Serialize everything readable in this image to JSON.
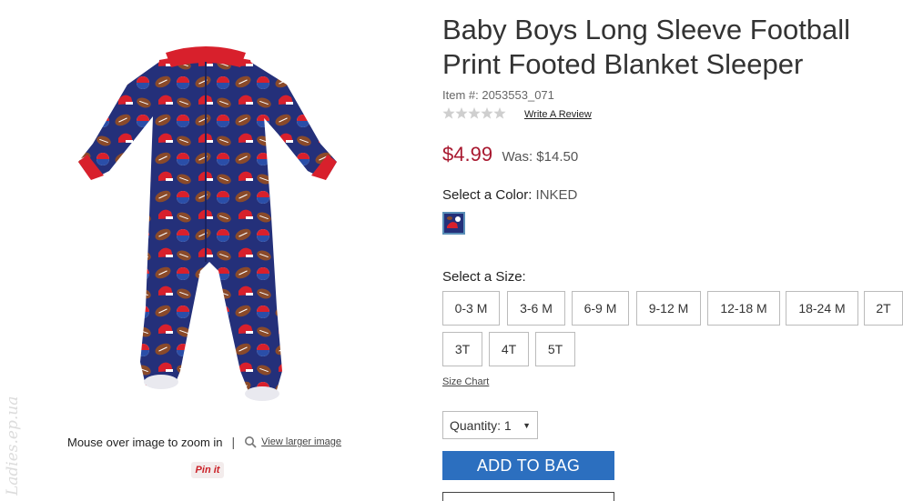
{
  "watermark": "Ladies.ep.ua",
  "gallery": {
    "zoom_hint": "Mouse over image to zoom in",
    "separator": "|",
    "larger_link": "View larger image",
    "pin_label": "Pin it"
  },
  "product": {
    "title": "Baby Boys Long Sleeve Football Print Footed Blanket Sleeper",
    "item_number": "Item #: 2053553_071",
    "rating_stars": 0,
    "review_link": "Write A Review",
    "price_now": "$4.99",
    "price_was": "Was: $14.50",
    "color_label": "Select a Color: ",
    "color_value": "INKED",
    "size_label": "Select a Size:",
    "sizes": [
      "0-3 M",
      "3-6 M",
      "6-9 M",
      "9-12 M",
      "12-18 M",
      "18-24 M",
      "2T",
      "3T",
      "4T",
      "5T"
    ],
    "size_chart": "Size Chart",
    "quantity_label": "Quantity:",
    "quantity_value": "1",
    "add_to_bag": "ADD TO BAG"
  },
  "colors": {
    "price_red": "#a8182f",
    "button_blue": "#2c6fbf",
    "sleeper_blue": "#24307a",
    "trim_red": "#d8202c"
  }
}
